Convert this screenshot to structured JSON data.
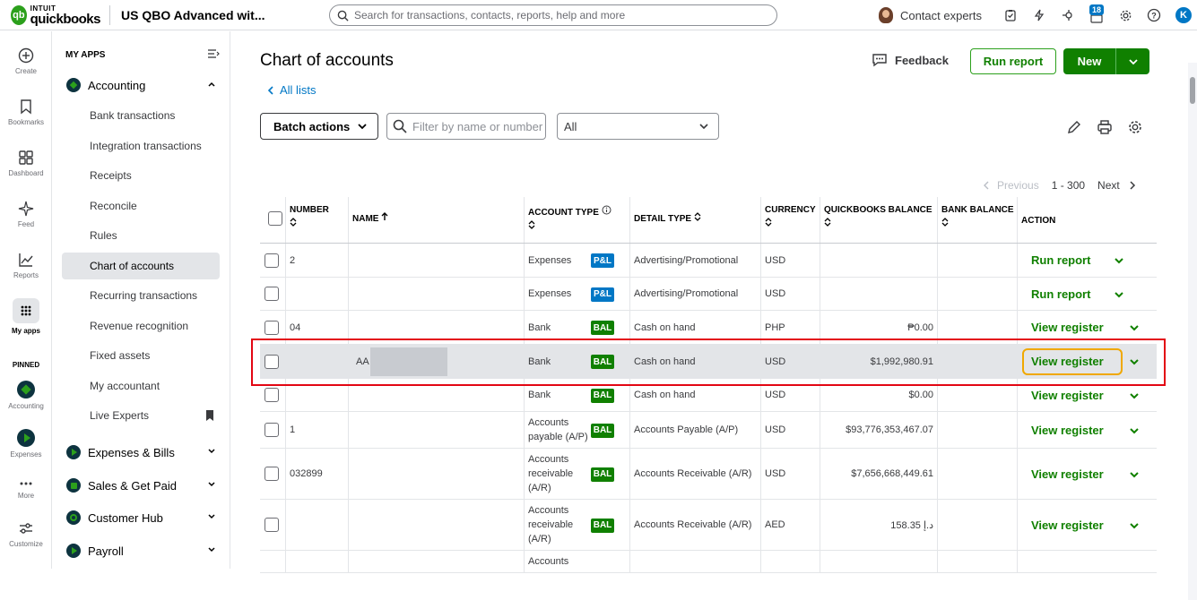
{
  "topbar": {
    "logo_intuit": "INTUIT",
    "logo_name": "quickbooks",
    "company": "US QBO Advanced wit...",
    "search_placeholder": "Search for transactions, contacts, reports, help and more",
    "contact_experts": "Contact experts",
    "notification_count": "18",
    "user_initial": "K"
  },
  "rail": {
    "items": [
      "Create",
      "Bookmarks",
      "Dashboard",
      "Feed",
      "Reports",
      "My apps"
    ],
    "pinned_label": "PINNED",
    "pinned": [
      "Accounting",
      "Expenses",
      "More",
      "Customize"
    ]
  },
  "sidenav": {
    "header": "MY APPS",
    "groups": [
      "Accounting",
      "Expenses & Bills",
      "Sales & Get Paid",
      "Customer Hub",
      "Payroll"
    ],
    "accounting_items": [
      "Bank transactions",
      "Integration transactions",
      "Receipts",
      "Reconcile",
      "Rules",
      "Chart of accounts",
      "Recurring transactions",
      "Revenue recognition",
      "Fixed assets",
      "My accountant",
      "Live Experts"
    ]
  },
  "main": {
    "title": "Chart of accounts",
    "all_lists": "All lists",
    "feedback": "Feedback",
    "run_report": "Run report",
    "new": "New",
    "batch_actions": "Batch actions",
    "filter_placeholder": "Filter by name or number",
    "type_filter": "All",
    "pager": {
      "previous": "Previous",
      "range": "1 - 300",
      "next": "Next"
    }
  },
  "table": {
    "headers": {
      "number": "NUMBER",
      "name": "NAME",
      "account_type": "ACCOUNT TYPE",
      "detail_type": "DETAIL TYPE",
      "currency": "CURRENCY",
      "qb_balance": "QUICKBOOKS BALANCE",
      "bank_balance": "BANK BALANCE",
      "action": "ACTION"
    },
    "rows": [
      {
        "number": "2",
        "name": "",
        "type": "Expenses",
        "tag": "P&L",
        "detail": "Advertising/Promotional",
        "currency": "USD",
        "balance": "",
        "action": "Run report"
      },
      {
        "number": "",
        "name": "",
        "type": "Expenses",
        "tag": "P&L",
        "detail": "Advertising/Promotional",
        "currency": "USD",
        "balance": "",
        "action": "Run report"
      },
      {
        "number": "04",
        "name": "",
        "type": "Bank",
        "tag": "BAL",
        "detail": "Cash on hand",
        "currency": "PHP",
        "balance": "₱0.00",
        "action": "View register"
      },
      {
        "number": "",
        "name": "AA",
        "type": "Bank",
        "tag": "BAL",
        "detail": "Cash on hand",
        "currency": "USD",
        "balance": "$1,992,980.91",
        "action": "View register"
      },
      {
        "number": "",
        "name": "",
        "type": "Bank",
        "tag": "BAL",
        "detail": "Cash on hand",
        "currency": "USD",
        "balance": "$0.00",
        "action": "View register"
      },
      {
        "number": "1",
        "name": "",
        "type": "Accounts payable (A/P)",
        "tag": "BAL",
        "detail": "Accounts Payable (A/P)",
        "currency": "USD",
        "balance": "$93,776,353,467.07",
        "action": "View register"
      },
      {
        "number": "032899",
        "name": "",
        "type": "Accounts receivable (A/R)",
        "tag": "BAL",
        "detail": "Accounts Receivable (A/R)",
        "currency": "USD",
        "balance": "$7,656,668,449.61",
        "action": "View register"
      },
      {
        "number": "",
        "name": "",
        "type": "Accounts receivable (A/R)",
        "tag": "BAL",
        "detail": "Accounts Receivable (A/R)",
        "currency": "AED",
        "balance": "158.35 د.إ",
        "action": "View register"
      },
      {
        "number": "",
        "name": "",
        "type": "Accounts",
        "tag": "",
        "detail": "",
        "currency": "",
        "balance": "",
        "action": ""
      }
    ]
  }
}
